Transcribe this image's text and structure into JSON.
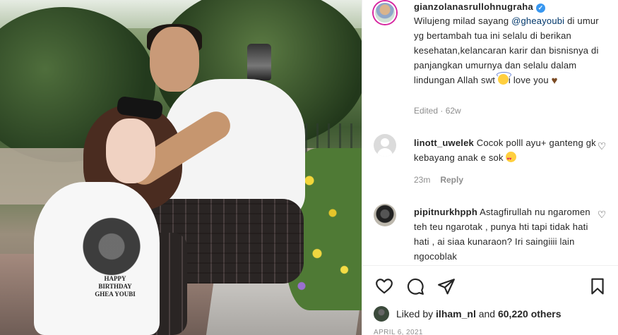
{
  "post": {
    "owner": "gianzolanasrullohnugraha",
    "caption_prefix": "Wilujeng milad sayang ",
    "caption_mention": "@gheayoubi",
    "caption_body": " di umur yg bertambah tua ini selalu di berikan kesehatan,kelancaran karir dan bisnisnya di panjangkan umurnya dan selalu dalam lindungan Allah swt ",
    "caption_tail": "i love you ",
    "edited": "Edited · 62w",
    "shirt_print": "HAPPY BIRTHDAY GHEA YOUBI"
  },
  "comments": [
    {
      "username": "linott_uwelek",
      "text": "Cocok polll ayu+ ganteng gk kebayang anak e sok",
      "time": "23m",
      "reply": "Reply"
    },
    {
      "username": "pipitnurkhpph",
      "text": "Astagfirullah nu ngaromen teh teu ngarotak , punya hti tapi tidak hati hati , ai siaa kunaraon? Iri saingiiii lain ngocoblak"
    }
  ],
  "likes": {
    "prefix": "Liked by ",
    "user": "ilham_nl",
    "middle": " and ",
    "count": "60,220 others"
  },
  "date": "APRIL 6, 2021",
  "icons": {
    "verified": "verified-badge-icon",
    "like": "heart-icon",
    "comment": "comment-bubble-icon",
    "share": "paper-plane-icon",
    "save": "bookmark-icon"
  }
}
